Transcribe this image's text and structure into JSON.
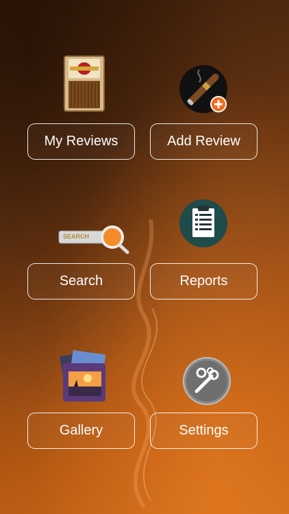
{
  "menu": {
    "my_reviews": {
      "label": "My Reviews",
      "icon": "cigar-box-icon"
    },
    "add_review": {
      "label": "Add Review",
      "icon": "add-cigar-icon"
    },
    "search": {
      "label": "Search",
      "icon": "search-bar-icon",
      "icon_text": "SEARCH"
    },
    "reports": {
      "label": "Reports",
      "icon": "clipboard-icon"
    },
    "gallery": {
      "label": "Gallery",
      "icon": "photo-gallery-icon"
    },
    "settings": {
      "label": "Settings",
      "icon": "settings-gear-icon"
    }
  },
  "colors": {
    "accent_orange": "#f26a1b",
    "button_border": "#ffffff"
  }
}
